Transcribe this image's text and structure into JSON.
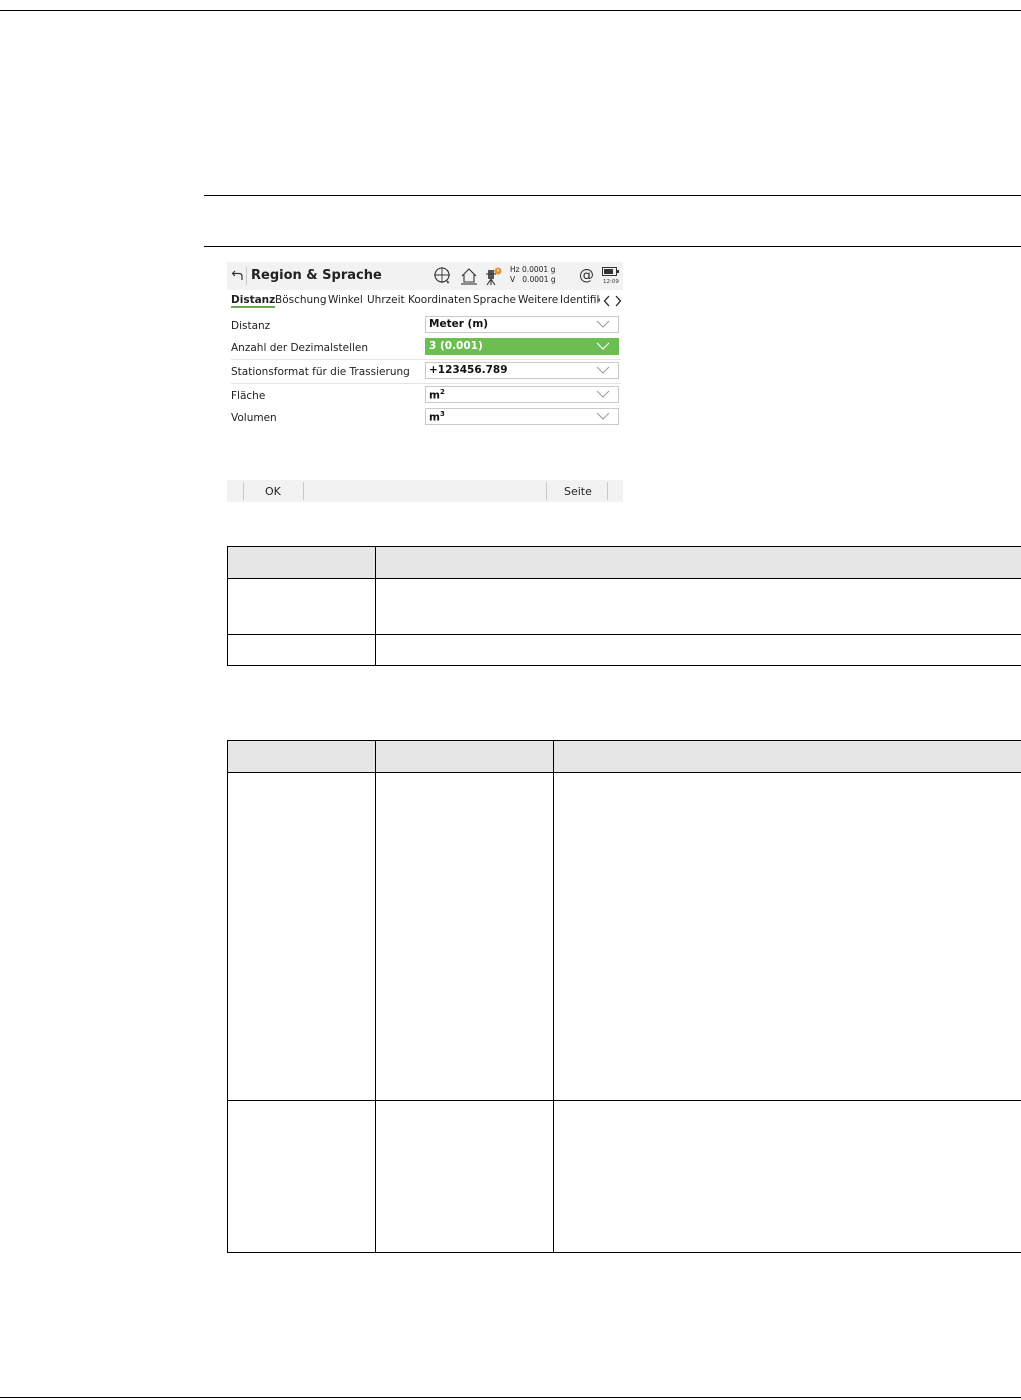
{
  "screen": {
    "title": "Region & Sprache",
    "status": {
      "hz": "Hz 0.0001 g",
      "v": "V   0.0001 g",
      "time": "12:09"
    },
    "tabs": [
      "Distanz",
      "Böschung",
      "Winkel",
      "Uhrzeit",
      "Koordinaten",
      "Sprache",
      "Weitere",
      "Identifik"
    ],
    "active_tab": "Distanz",
    "fields": [
      {
        "label": "Distanz",
        "value": "Meter (m)"
      },
      {
        "label": "Anzahl der Dezimalstellen",
        "value": "3 (0.001)",
        "selected": true
      },
      {
        "label": "Stationsformat für die Trassierung",
        "value": "+123456.789"
      },
      {
        "label": "Fläche",
        "value_base": "m",
        "value_sup": "2"
      },
      {
        "label": "Volumen",
        "value_base": "m",
        "value_sup": "3"
      }
    ],
    "softkeys": {
      "ok": "OK",
      "page": "Seite"
    },
    "colors": {
      "selected_field": "#6cbd52",
      "active_tab_underline": "#6aa84f"
    }
  }
}
